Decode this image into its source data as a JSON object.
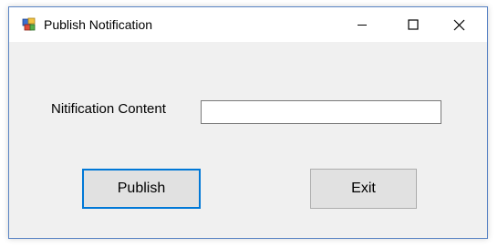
{
  "window": {
    "title": "Publish Notification",
    "icon": "winforms-app-icon",
    "controls": {
      "minimize_icon": "minimize-icon",
      "maximize_icon": "maximize-icon",
      "close_icon": "close-icon"
    }
  },
  "form": {
    "content_label": "Nitification Content",
    "content_value": "",
    "content_placeholder": ""
  },
  "buttons": {
    "publish_label": "Publish",
    "exit_label": "Exit"
  },
  "colors": {
    "window_background": "#f0f0f0",
    "title_bar": "#ffffff",
    "focus_border": "#0078d7",
    "button_face": "#e1e1e1",
    "window_border": "#5a84c4"
  }
}
